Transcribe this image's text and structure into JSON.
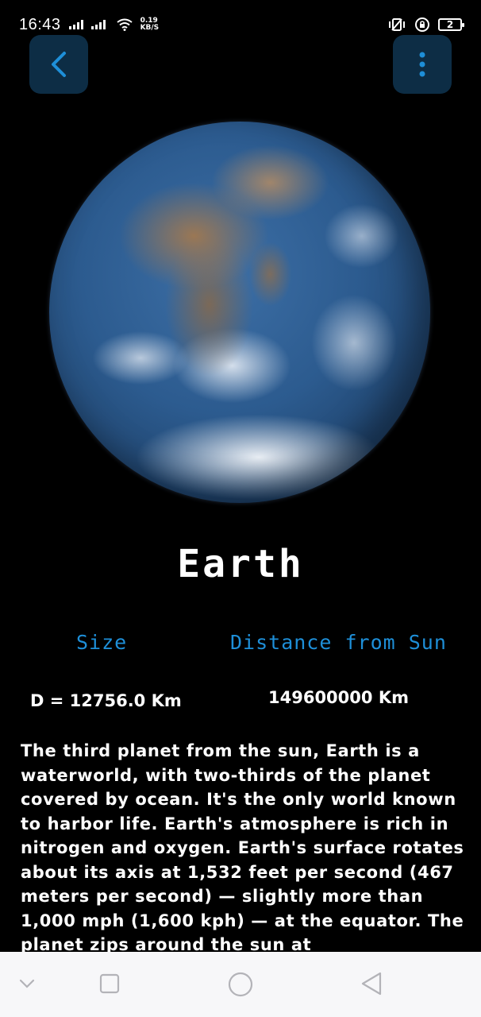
{
  "status_bar": {
    "time": "16:43",
    "net_speed_value": "0.19",
    "net_speed_unit": "KB/S",
    "battery_level": "2"
  },
  "toolbar": {
    "back_icon": "chevron-left-icon",
    "menu_icon": "more-vertical-icon",
    "accent_color": "#1e8fd8",
    "button_bg": "#0d2d45"
  },
  "planet": {
    "name": "Earth",
    "image": "earth-globe"
  },
  "stats": {
    "size_label": "Size",
    "size_value": "D = 12756.0 Km",
    "distance_label": "Distance from Sun",
    "distance_value": "149600000 Km"
  },
  "description": "The third planet from the sun, Earth is a waterworld, with two-thirds of the planet covered by ocean. It's the only world known to harbor life. Earth's atmosphere is rich in nitrogen and oxygen. Earth's surface rotates about its axis at 1,532 feet per second (467 meters per second) — slightly more than 1,000 mph (1,600 kph) — at the equator. The planet zips around the sun at",
  "nav_bar": {
    "items": [
      "collapse-icon",
      "recents-icon",
      "home-icon",
      "back-icon"
    ]
  }
}
